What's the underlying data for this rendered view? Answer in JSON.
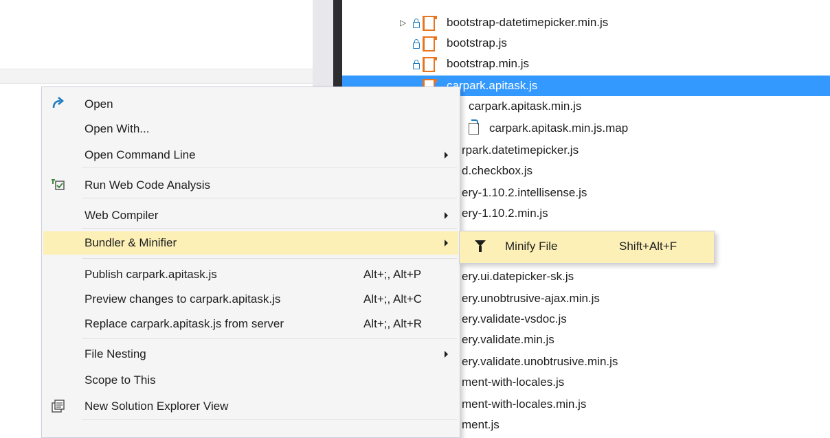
{
  "tree": {
    "items": [
      {
        "label": "bootstrap-datetimepicker.min.js",
        "expandable": true
      },
      {
        "label": "bootstrap.js"
      },
      {
        "label": "bootstrap.min.js"
      },
      {
        "label": "carpark.apitask.js",
        "selected": true
      },
      {
        "label": "carpark.apitask.min.js"
      },
      {
        "label": "carpark.apitask.min.js.map"
      },
      {
        "label": "rpark.datetimepicker.js"
      },
      {
        "label": "d.checkbox.js"
      },
      {
        "label": "ery-1.10.2.intellisense.js"
      },
      {
        "label": "ery-1.10.2.min.js"
      },
      {
        "label": "ery.ui.datepicker-sk.js"
      },
      {
        "label": "ery.unobtrusive-ajax.min.js"
      },
      {
        "label": "ery.validate-vsdoc.js"
      },
      {
        "label": "ery.validate.min.js"
      },
      {
        "label": "ery.validate.unobtrusive.min.js"
      },
      {
        "label": "ment-with-locales.js"
      },
      {
        "label": "ment-with-locales.min.js"
      },
      {
        "label": "ment.js"
      }
    ]
  },
  "context_menu": {
    "items": [
      {
        "label": "Open",
        "icon": "open-arrow-icon"
      },
      {
        "label": "Open With..."
      },
      {
        "label": "Open Command Line",
        "has_submenu": true
      },
      {
        "label": "Run Web Code Analysis",
        "icon": "code-analysis-icon"
      },
      {
        "label": "Web Compiler",
        "has_submenu": true
      },
      {
        "label": "Bundler & Minifier",
        "has_submenu": true,
        "highlighted": true
      },
      {
        "label": "Publish carpark.apitask.js",
        "shortcut": "Alt+;, Alt+P"
      },
      {
        "label": "Preview changes to carpark.apitask.js",
        "shortcut": "Alt+;, Alt+C"
      },
      {
        "label": "Replace carpark.apitask.js from server",
        "shortcut": "Alt+;, Alt+R"
      },
      {
        "label": "File Nesting",
        "has_submenu": true
      },
      {
        "label": "Scope to This"
      },
      {
        "label": "New Solution Explorer View",
        "icon": "new-explorer-view-icon"
      }
    ]
  },
  "submenu": {
    "label": "Minify File",
    "shortcut": "Shift+Alt+F",
    "icon": "funnel-icon"
  },
  "colors": {
    "selection": "#3399ff",
    "highlight": "#fcf0b7",
    "splitter": "#2d2d30",
    "js_icon": "#e8741e"
  }
}
